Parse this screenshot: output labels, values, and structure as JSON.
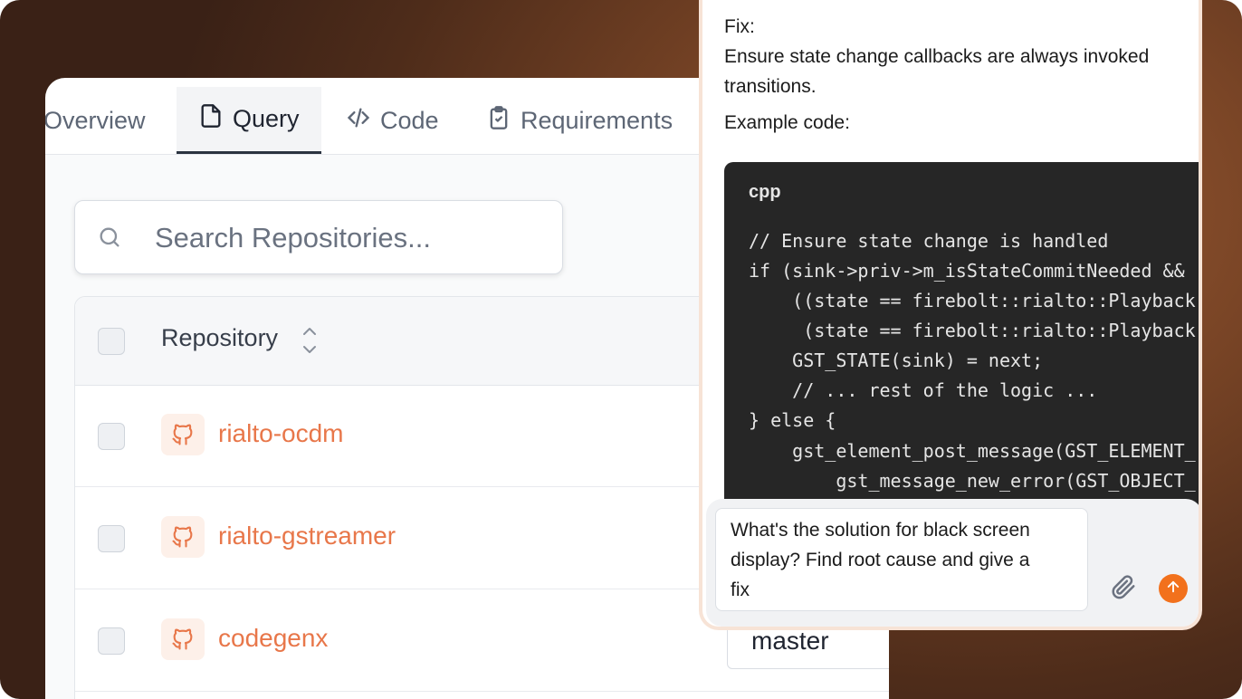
{
  "tabs": [
    {
      "label": "Overview",
      "icon": "none"
    },
    {
      "label": "Query",
      "icon": "file-icon"
    },
    {
      "label": "Code",
      "icon": "code-icon"
    },
    {
      "label": "Requirements",
      "icon": "clipboard-icon"
    }
  ],
  "search": {
    "placeholder": "Search Repositories..."
  },
  "table": {
    "header": {
      "repository": "Repository"
    },
    "rows": [
      {
        "name": "rialto-ocdm"
      },
      {
        "name": "rialto-gstreamer"
      },
      {
        "name": "codegenx",
        "branch": "master"
      }
    ]
  },
  "chat": {
    "fix_label": "Fix:",
    "fix_text_1": "Ensure state change callbacks are always invoked",
    "fix_text_2": "transitions.",
    "example_label": "Example code:",
    "code": {
      "language": "cpp",
      "lines": [
        "// Ensure state change is handled",
        "if (sink->priv->m_isStateCommitNeeded &&",
        "    ((state == firebolt::rialto::Playback",
        "     (state == firebolt::rialto::Playback",
        "    GST_STATE(sink) = next;",
        "    // ... rest of the logic ...",
        "} else {",
        "    gst_element_post_message(GST_ELEMENT_",
        "        gst_message_new_error(GST_OBJECT_"
      ]
    },
    "prompt_lines": [
      "What's the solution for black screen",
      "display? Find root cause and give a",
      "fix"
    ]
  },
  "colors": {
    "accent": "#f2711c",
    "repo_link": "#e8774a"
  }
}
